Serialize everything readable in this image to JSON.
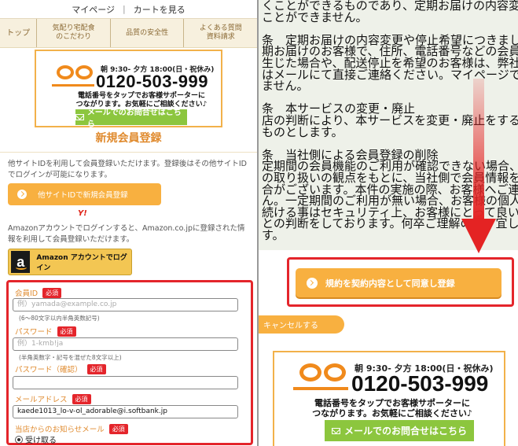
{
  "left": {
    "topnav": {
      "mypage": "マイページ",
      "sep": "|",
      "cart": "カートを見る"
    },
    "catnav": [
      {
        "line1": "トップ",
        "line2": ""
      },
      {
        "line1": "気配り宅配食",
        "line2": "のこだわり"
      },
      {
        "line1": "品質の安全性",
        "line2": ""
      },
      {
        "line1": "よくある質問",
        "line2": "資料請求"
      }
    ],
    "phone": {
      "hours": "朝 9:30- 夕方 18:00(日・祝休み)",
      "number": "0120-503-999",
      "note1": "電話番号をタップでお客様サポーターに",
      "note2": "つながります。お気軽にご相談ください♪",
      "mail_label": "メールでのお問合せはこちら"
    },
    "registration_title": "新規会員登録",
    "other_site_text": "他サイトIDを利用して会員登録いただけます。登録後はその他サイトIDでログインが可能になります。",
    "other_site_button": "他サイトIDで新規会員登録",
    "yahoo_logo": "Y!",
    "amazon_text": "Amazonアカウントでログインすると、Amazon.co.jpに登録された情報を利用して会員登録いただけます。",
    "amazon_icon_letter": "a",
    "amazon_button": "Amazon アカウントでログイン",
    "form": {
      "member_id_label": "会員ID",
      "required": "必須",
      "member_id_placeholder": "例）yamada@example.co.jp",
      "member_id_hint": "(6～80文字以内半角英数記号)",
      "password_label": "パスワード",
      "password_placeholder": "例）1-kmb!ja",
      "password_hint": "(半角英数字・記号を混ぜた8文字以上)",
      "password_confirm_label": "パスワード（確認）",
      "email_label": "メールアドレス",
      "email_value": "kaede1013_lo-v-ol_adorable@i.softbank.jp",
      "newsletter_label": "当店からのお知らせメール",
      "newsletter_option": "受け取る"
    }
  },
  "right": {
    "terms_lines": [
      "くことができるものであり、定期お届けの内容変更",
      "ことができません。",
      "",
      "条　定期お届けの内容変更や停止希望につきまして",
      "期お届けのお客様で、住所、電話番号などの会員情報",
      "生じた場合や、配送停止を希望のお客様は、弊社まで電",
      "はメールにて直接ご連絡ください。マイページでの変更",
      "ません。",
      "",
      "条　本サービスの変更・廃止",
      "店の判断により、本サービスを変更・廃止をすること",
      "ものとします。",
      "",
      "条　当社側による会員登録の削除",
      "定期間の会員機能のご利用が確認できない場合、弊社",
      "の取り扱いの観点をもとに、当社側で会員情報を削除を",
      "合がございます。本件の実施の際、お客様へご連絡は行",
      "ん。一定期間のご利用が無い場合、お客様の個人情報を",
      "続ける事はセキュリティ上、お客様にとって良い環境で",
      "との判断をしております。何卒ご理解の程、宜しくお願",
      "す。"
    ],
    "agree_button": "規約を契約内容として同意し登録",
    "cancel_button": "キャンセルする",
    "phone": {
      "hours": "朝 9:30- 夕方 18:00(日・祝休み)",
      "number": "0120-503-999",
      "note1": "電話番号をタップでお客様サポーターに",
      "note2": "つながります。お気軽にご相談ください♪",
      "mail_label": "メールでのお問合せはこちら"
    }
  },
  "colors": {
    "accent_orange": "#f8b040",
    "highlight_red": "#e4252b",
    "mail_green": "#8cc63e",
    "label_orange": "#e08b2f"
  }
}
